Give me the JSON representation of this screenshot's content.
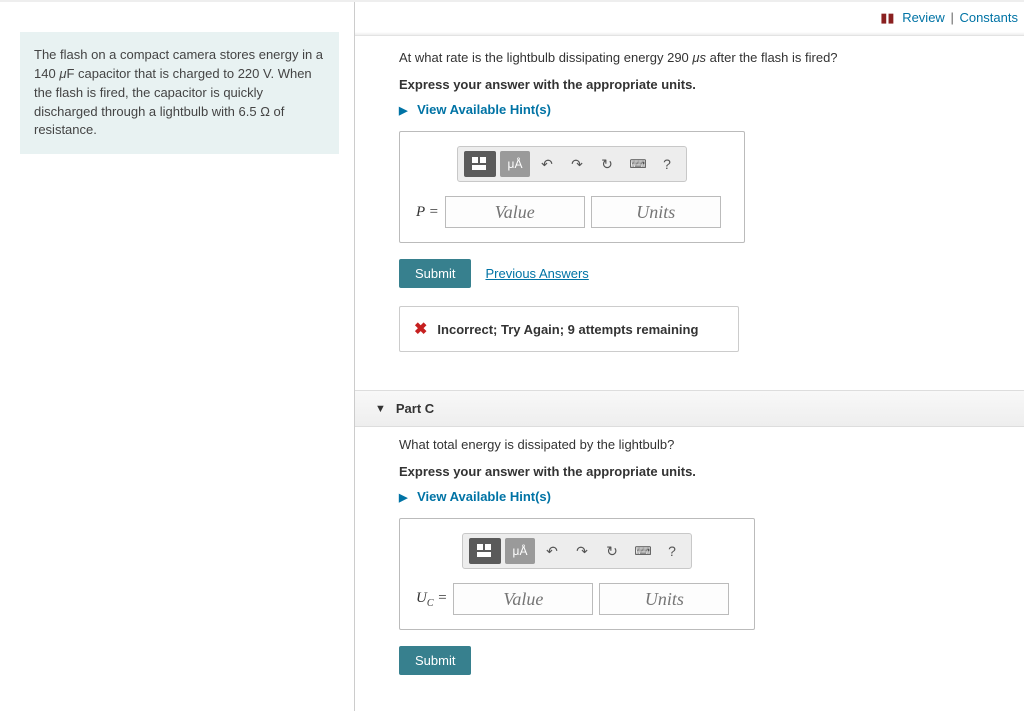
{
  "top_links": {
    "review": "Review",
    "constants": "Constants",
    "sep": "|"
  },
  "problem_text": "The flash on a compact camera stores energy in a 140 μF capacitor that is charged to 220 V. When the flash is fired, the capacitor is quickly discharged through a lightbulb with 6.5 Ω of resistance.",
  "partB": {
    "question": "At what rate is the lightbulb dissipating energy 290 μs after the flash is fired?",
    "instruction": "Express your answer with the appropriate units.",
    "hints_label": "View Available Hint(s)",
    "var_label": "P =",
    "value_placeholder": "Value",
    "units_placeholder": "Units",
    "submit": "Submit",
    "previous": "Previous Answers",
    "feedback": "Incorrect; Try Again; 9 attempts remaining"
  },
  "partC": {
    "title": "Part C",
    "question": "What total energy is dissipated by the lightbulb?",
    "instruction": "Express your answer with the appropriate units.",
    "hints_label": "View Available Hint(s)",
    "var_label": "U_C =",
    "value_placeholder": "Value",
    "units_placeholder": "Units",
    "submit": "Submit"
  },
  "toolbar": {
    "ua": "μÅ",
    "help": "?"
  }
}
